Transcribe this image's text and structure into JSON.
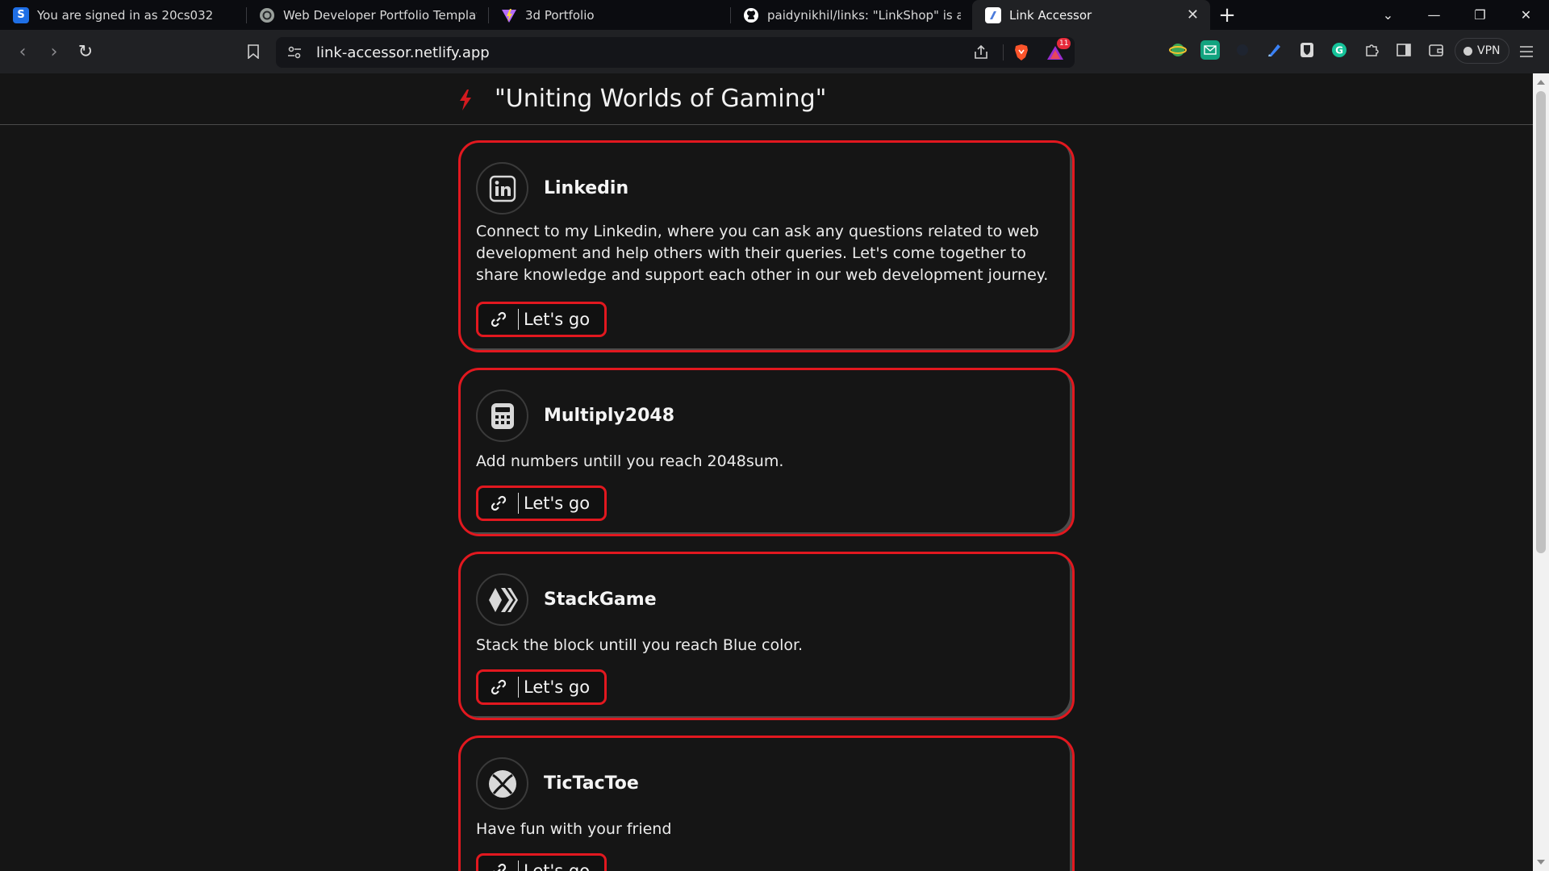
{
  "browser": {
    "tabs": [
      {
        "title": "You are signed in as 20cs032",
        "favicon": "S",
        "favicon_color": "#1f6fe6",
        "active": false
      },
      {
        "title": "Web Developer Portfolio Template",
        "favicon": "chatgpt-icon",
        "favicon_color": "#9aa09c",
        "active": false
      },
      {
        "title": "3d Portfolio",
        "favicon": "vite-icon",
        "favicon_color": "#b46cff",
        "active": false
      },
      {
        "title": "paidynikhil/links: \"LinkShop\" is a React",
        "favicon": "github-icon",
        "favicon_color": "#ffffff",
        "active": false
      },
      {
        "title": "Link Accessor",
        "favicon": "link-icon",
        "favicon_color": "#4c7bdb",
        "active": true
      }
    ],
    "new_tab": "+",
    "address_url": "link-accessor.netlify.app",
    "notification_count": "11",
    "vpn_label": "VPN"
  },
  "page": {
    "header_title": "\"Uniting Worlds of Gaming\"",
    "accent_color": "#e2181f",
    "cards": [
      {
        "title": "Linkedin",
        "icon": "linkedin-icon",
        "description": "Connect to my Linkedin, where you can ask any questions related to web development and help others with their queries. Let's come together to share knowledge and support each other in our web development journey.",
        "button_label": "Let's go"
      },
      {
        "title": "Multiply2048",
        "icon": "calculator-icon",
        "description": "Add numbers untill you reach 2048sum.",
        "button_label": "Let's go"
      },
      {
        "title": "StackGame",
        "icon": "stack-chevrons-icon",
        "description": "Stack the block untill you reach Blue color.",
        "button_label": "Let's go"
      },
      {
        "title": "TicTacToe",
        "icon": "xbox-icon",
        "description": "Have fun with your friend",
        "button_label": "Let's go"
      }
    ]
  }
}
